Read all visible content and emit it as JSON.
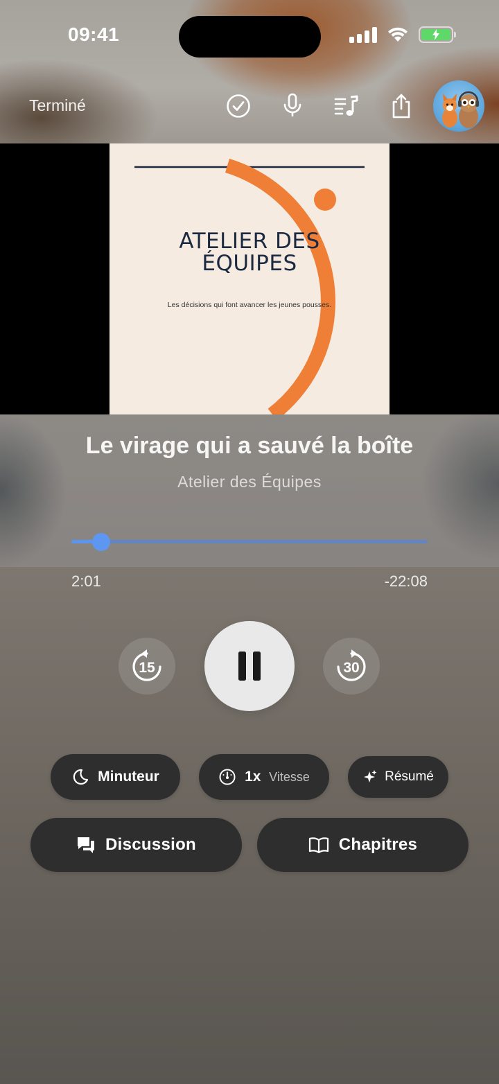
{
  "status_bar": {
    "time": "09:41"
  },
  "toolbar": {
    "done_label": "Terminé",
    "icons": [
      "checkmark-circle-icon",
      "microphone-icon",
      "queue-music-icon",
      "share-icon"
    ]
  },
  "artwork": {
    "title": "ATELIER DES ÉQUIPES",
    "title_line1": "ATELIER DES",
    "title_line2": "ÉQUIPES",
    "subtitle": "Les décisions qui font avancer les jeunes pousses.",
    "colors": {
      "background": "#f6ebe0",
      "accent": "#ef7f36",
      "text": "#1c2a41"
    }
  },
  "episode": {
    "title": "Le virage qui a sauvé la boîte",
    "show": "Atelier des Équipes"
  },
  "progress": {
    "elapsed": "2:01",
    "remaining": "-22:08",
    "fraction": 0.084,
    "color": "#5b95ef"
  },
  "transport": {
    "skip_back_seconds": "15",
    "skip_forward_seconds": "30",
    "state": "playing"
  },
  "actions": {
    "timer_label": "Minuteur",
    "speed_value": "1x",
    "speed_label": "Vitesse",
    "summary_label": "Résumé",
    "discussion_label": "Discussion",
    "chapters_label": "Chapitres"
  }
}
